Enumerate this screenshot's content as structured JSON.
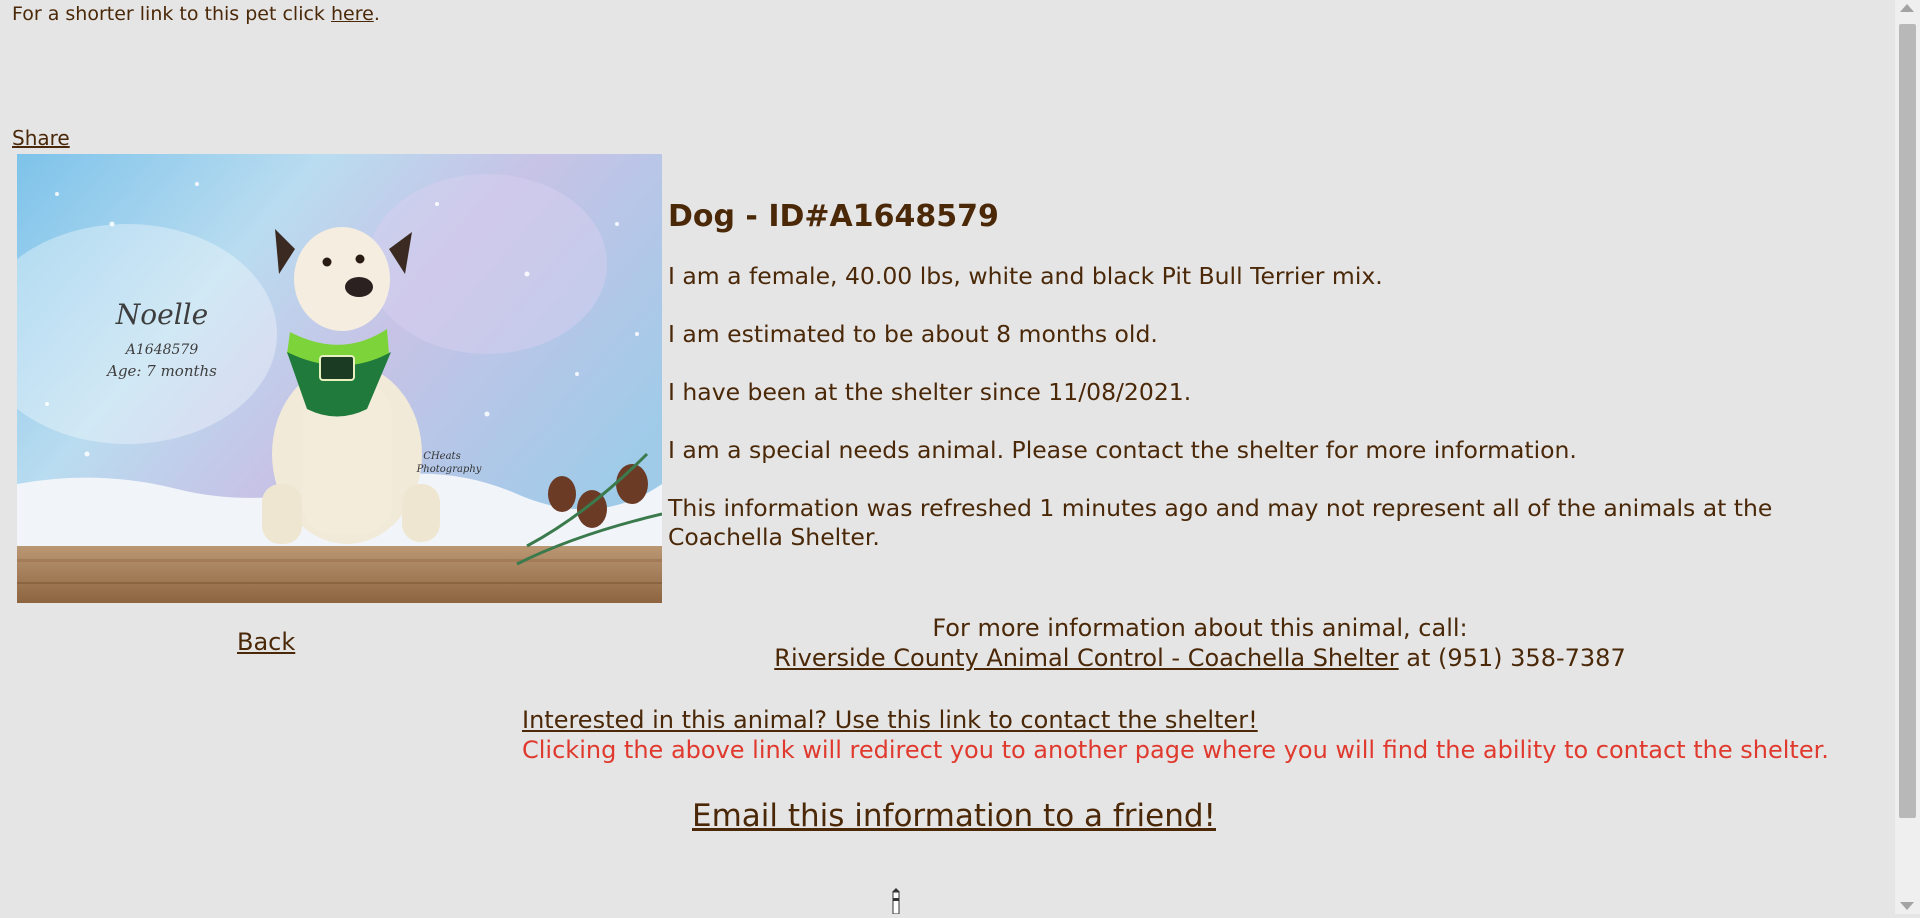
{
  "header": {
    "shorter_link_prefix": "For a shorter link to this pet click ",
    "shorter_link_text": "here",
    "shorter_link_suffix": "."
  },
  "share_label": "Share",
  "photo": {
    "name_text": "Noelle",
    "id_text": "A1648579",
    "age_text": "Age: 7 months",
    "credit_line1": "CHeats",
    "credit_line2": "Photography"
  },
  "back_label": "Back",
  "animal": {
    "title": "Dog - ID#A1648579",
    "description": "I am a female, 40.00 lbs, white and black Pit Bull Terrier mix.",
    "age_estimate": "I am estimated to be about 8 months old.",
    "shelter_since": "I have been at the shelter since 11/08/2021.",
    "special_needs": "I am a special needs animal. Please contact the shelter for more information.",
    "refresh_note": "This information was refreshed 1 minutes ago and may not represent all of the animals at the Coachella Shelter."
  },
  "contact": {
    "call_text": "For more information about this animal, call:",
    "shelter_link": "Riverside County Animal Control - Coachella Shelter",
    "phone_text": " at (951) 358-7387",
    "interest_link": "Interested in this animal? Use this link to contact the shelter!",
    "redirect_note": "Clicking the above link will redirect you to another page where you will find the ability to contact the shelter.",
    "redirect_color": "#e03a2e"
  },
  "email_link": "Email this information to a friend!",
  "colors": {
    "text": "#4a2808",
    "background": "#e5e5e5"
  }
}
